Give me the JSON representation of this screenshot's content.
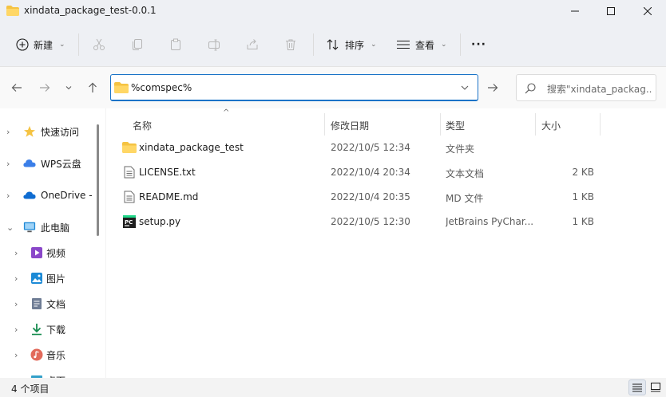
{
  "window": {
    "title": "xindata_package_test-0.0.1"
  },
  "toolbar": {
    "new_label": "新建",
    "sort_label": "排序",
    "view_label": "查看",
    "more_label": "···"
  },
  "address": {
    "value": "%comspec%"
  },
  "search": {
    "placeholder": "搜索\"xindata_packag..."
  },
  "sidebar": {
    "items": [
      {
        "label": "快速访问",
        "icon": "star-icon"
      },
      {
        "label": "WPS云盘",
        "icon": "cloud-icon"
      },
      {
        "label": "OneDrive -",
        "icon": "onedrive-icon"
      },
      {
        "label": "此电脑",
        "icon": "computer-icon"
      },
      {
        "label": "视频",
        "icon": "video-icon"
      },
      {
        "label": "图片",
        "icon": "pictures-icon"
      },
      {
        "label": "文档",
        "icon": "documents-icon"
      },
      {
        "label": "下载",
        "icon": "download-icon"
      },
      {
        "label": "音乐",
        "icon": "music-icon"
      },
      {
        "label": "桌面",
        "icon": "desktop-icon"
      }
    ]
  },
  "columns": {
    "name": "名称",
    "date": "修改日期",
    "type": "类型",
    "size": "大小"
  },
  "files": [
    {
      "name": "xindata_package_test",
      "date": "2022/10/5 12:34",
      "type": "文件夹",
      "size": "",
      "icon": "folder-icon"
    },
    {
      "name": "LICENSE.txt",
      "date": "2022/10/4 20:34",
      "type": "文本文档",
      "size": "2 KB",
      "icon": "text-file-icon"
    },
    {
      "name": "README.md",
      "date": "2022/10/4 20:35",
      "type": "MD 文件",
      "size": "1 KB",
      "icon": "md-file-icon"
    },
    {
      "name": "setup.py",
      "date": "2022/10/5 12:30",
      "type": "JetBrains PyChar...",
      "size": "1 KB",
      "icon": "pycharm-icon"
    }
  ],
  "status": {
    "count": "4 个项目"
  },
  "colors": {
    "accent": "#1a73c7",
    "folder": "#f5c342"
  }
}
